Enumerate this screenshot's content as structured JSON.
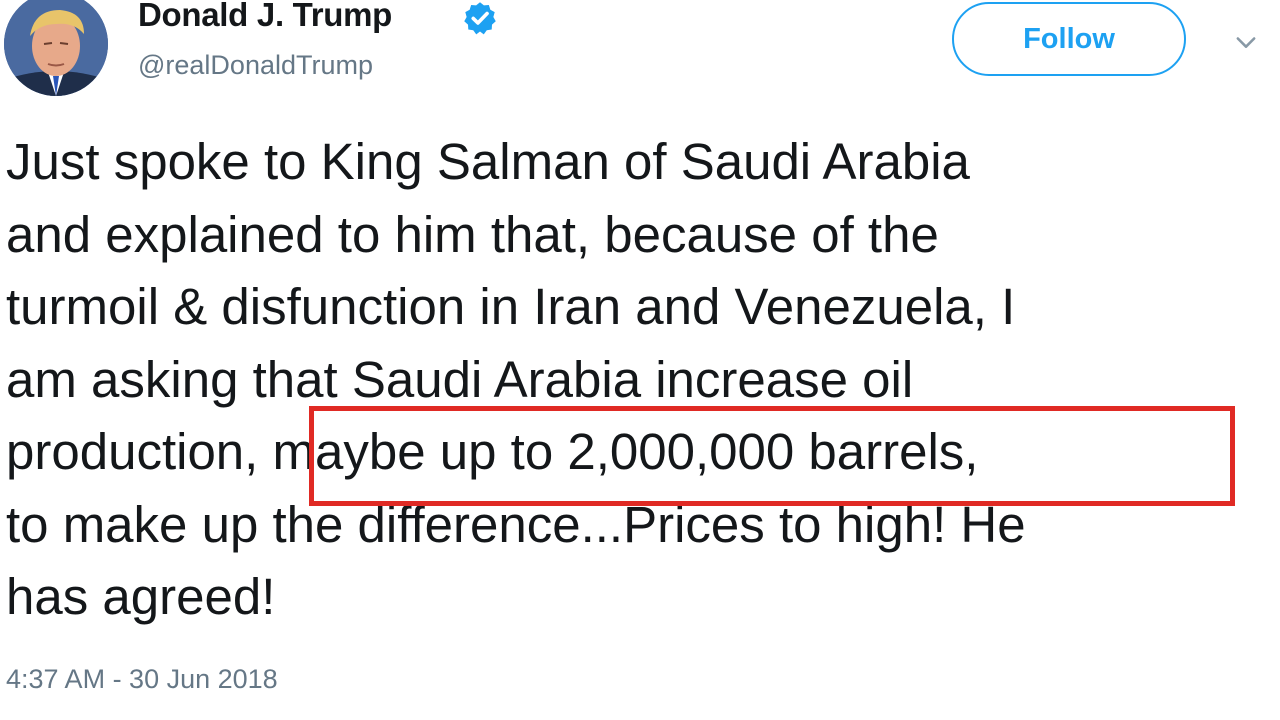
{
  "author": {
    "display_name": "Donald J. Trump",
    "handle": "@realDonaldTrump",
    "verified": true,
    "avatar_icon": "profile-photo"
  },
  "actions": {
    "follow_label": "Follow",
    "menu_icon": "chevron-down-icon"
  },
  "tweet": {
    "lines": [
      "Just spoke to King Salman of Saudi Arabia",
      "and explained to him that, because of the",
      "turmoil & disfunction in Iran and Venezuela, I",
      "am asking that Saudi Arabia increase oil",
      "production, maybe up to 2,000,000 barrels,",
      "to make up the difference...Prices to high! He",
      "has agreed!"
    ],
    "timestamp": "4:37 AM - 30 Jun 2018"
  },
  "colors": {
    "accent": "#1da1f2",
    "highlight_box": "#e02a24",
    "text": "#14171a",
    "muted": "#657786"
  }
}
